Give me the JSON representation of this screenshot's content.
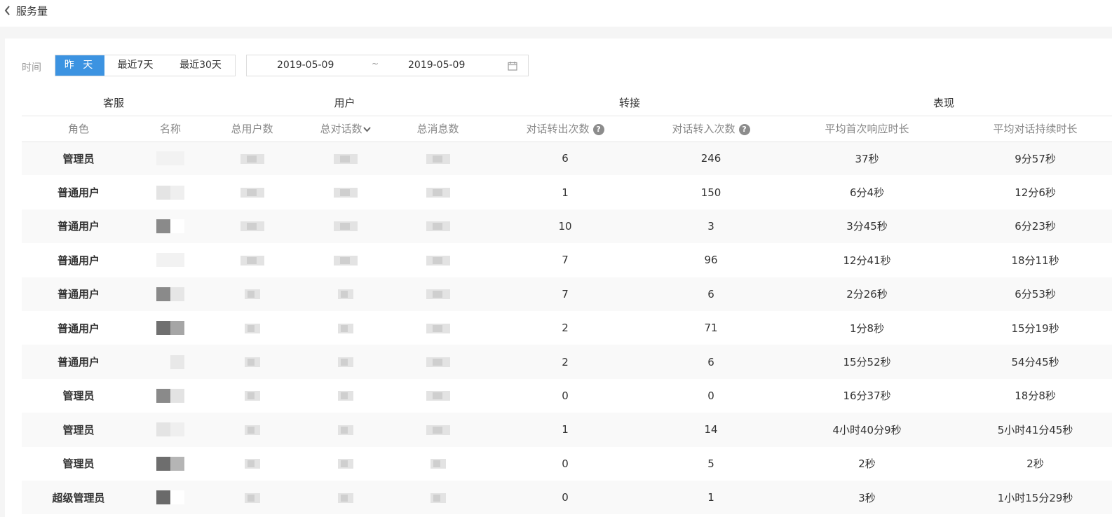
{
  "header": {
    "title": "服务量"
  },
  "filter": {
    "label": "时间",
    "ranges": [
      "昨 天",
      "最近7天",
      "最近30天"
    ],
    "active_range": "昨 天",
    "date_start": "2019-05-09",
    "date_separator": "~",
    "date_end": "2019-05-09"
  },
  "table": {
    "groups": [
      "客服",
      "用户",
      "转接",
      "表现"
    ],
    "columns": [
      "角色",
      "名称",
      "总用户数",
      "总对话数",
      "总消息数",
      "对话转出次数",
      "对话转入次数",
      "平均首次响应时长",
      "平均对话持续时长"
    ],
    "sorted_column": "总对话数",
    "rows": [
      {
        "role": "管理员",
        "transfer_out": "6",
        "transfer_in": "246",
        "first_response": "37秒",
        "duration": "9分57秒"
      },
      {
        "role": "普通用户",
        "transfer_out": "1",
        "transfer_in": "150",
        "first_response": "6分4秒",
        "duration": "12分6秒"
      },
      {
        "role": "普通用户",
        "transfer_out": "10",
        "transfer_in": "3",
        "first_response": "3分45秒",
        "duration": "6分23秒"
      },
      {
        "role": "普通用户",
        "transfer_out": "7",
        "transfer_in": "96",
        "first_response": "12分41秒",
        "duration": "18分11秒"
      },
      {
        "role": "普通用户",
        "transfer_out": "7",
        "transfer_in": "6",
        "first_response": "2分26秒",
        "duration": "6分53秒"
      },
      {
        "role": "普通用户",
        "transfer_out": "2",
        "transfer_in": "71",
        "first_response": "1分8秒",
        "duration": "15分19秒"
      },
      {
        "role": "普通用户",
        "transfer_out": "2",
        "transfer_in": "6",
        "first_response": "15分52秒",
        "duration": "54分45秒"
      },
      {
        "role": "管理员",
        "transfer_out": "0",
        "transfer_in": "0",
        "first_response": "16分37秒",
        "duration": "18分8秒"
      },
      {
        "role": "管理员",
        "transfer_out": "1",
        "transfer_in": "14",
        "first_response": "4小时40分9秒",
        "duration": "5小时41分45秒"
      },
      {
        "role": "管理员",
        "transfer_out": "0",
        "transfer_in": "5",
        "first_response": "2秒",
        "duration": "2秒"
      },
      {
        "role": "超级管理员",
        "transfer_out": "0",
        "transfer_in": "1",
        "first_response": "3秒",
        "duration": "1小时15分29秒"
      }
    ]
  },
  "colors": {
    "accent": "#3c93e1",
    "help_icon": "#8c8c8c"
  },
  "icons": {
    "back": "chevron-left-icon",
    "calendar": "calendar-icon",
    "help": "question-circle-icon",
    "sort": "chevron-down-icon"
  }
}
